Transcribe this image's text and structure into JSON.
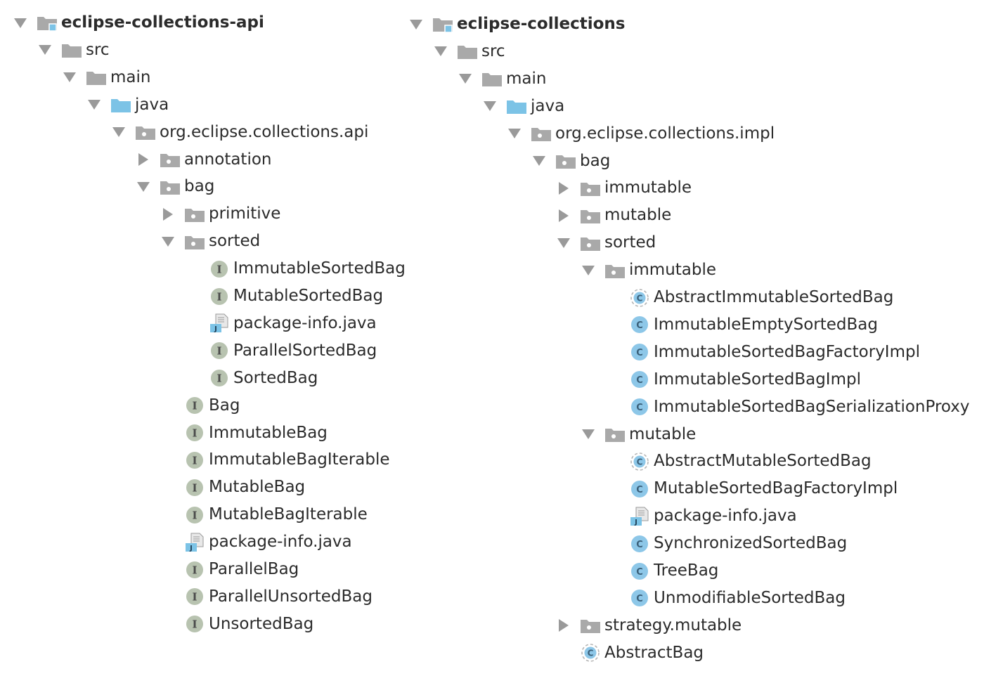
{
  "left_tree": [
    {
      "label": "eclipse-collections-api",
      "icon": "module-folder-icon",
      "arrow": "down",
      "bold": true,
      "depth": 0
    },
    {
      "label": "src",
      "icon": "folder-icon",
      "arrow": "down",
      "depth": 1
    },
    {
      "label": "main",
      "icon": "folder-icon",
      "arrow": "down",
      "depth": 2
    },
    {
      "label": "java",
      "icon": "source-folder-icon",
      "arrow": "down",
      "depth": 3
    },
    {
      "label": "org.eclipse.collections.api",
      "icon": "package-icon",
      "arrow": "down",
      "depth": 4
    },
    {
      "label": "annotation",
      "icon": "package-icon",
      "arrow": "right",
      "depth": 5
    },
    {
      "label": "bag",
      "icon": "package-icon",
      "arrow": "down",
      "depth": 5
    },
    {
      "label": "primitive",
      "icon": "package-icon",
      "arrow": "right",
      "depth": 6
    },
    {
      "label": "sorted",
      "icon": "package-icon",
      "arrow": "down",
      "depth": 6
    },
    {
      "label": "ImmutableSortedBag",
      "icon": "interface-icon",
      "arrow": "none",
      "depth": 7
    },
    {
      "label": "MutableSortedBag",
      "icon": "interface-icon",
      "arrow": "none",
      "depth": 7
    },
    {
      "label": "package-info.java",
      "icon": "java-file-icon",
      "arrow": "none",
      "depth": 7
    },
    {
      "label": "ParallelSortedBag",
      "icon": "interface-icon",
      "arrow": "none",
      "depth": 7
    },
    {
      "label": "SortedBag",
      "icon": "interface-icon",
      "arrow": "none",
      "depth": 7
    },
    {
      "label": "Bag",
      "icon": "interface-icon",
      "arrow": "none",
      "depth": 6
    },
    {
      "label": "ImmutableBag",
      "icon": "interface-icon",
      "arrow": "none",
      "depth": 6
    },
    {
      "label": "ImmutableBagIterable",
      "icon": "interface-icon",
      "arrow": "none",
      "depth": 6
    },
    {
      "label": "MutableBag",
      "icon": "interface-icon",
      "arrow": "none",
      "depth": 6
    },
    {
      "label": "MutableBagIterable",
      "icon": "interface-icon",
      "arrow": "none",
      "depth": 6
    },
    {
      "label": "package-info.java",
      "icon": "java-file-icon",
      "arrow": "none",
      "depth": 6
    },
    {
      "label": "ParallelBag",
      "icon": "interface-icon",
      "arrow": "none",
      "depth": 6
    },
    {
      "label": "ParallelUnsortedBag",
      "icon": "interface-icon",
      "arrow": "none",
      "depth": 6
    },
    {
      "label": "UnsortedBag",
      "icon": "interface-icon",
      "arrow": "none",
      "depth": 6
    }
  ],
  "right_tree": [
    {
      "label": "eclipse-collections",
      "icon": "module-folder-icon",
      "arrow": "down",
      "bold": true,
      "depth": 0
    },
    {
      "label": "src",
      "icon": "folder-icon",
      "arrow": "down",
      "depth": 1
    },
    {
      "label": "main",
      "icon": "folder-icon",
      "arrow": "down",
      "depth": 2
    },
    {
      "label": "java",
      "icon": "source-folder-icon",
      "arrow": "down",
      "depth": 3
    },
    {
      "label": "org.eclipse.collections.impl",
      "icon": "package-icon",
      "arrow": "down",
      "depth": 4
    },
    {
      "label": "bag",
      "icon": "package-icon",
      "arrow": "down",
      "depth": 5
    },
    {
      "label": "immutable",
      "icon": "package-icon",
      "arrow": "right",
      "depth": 6
    },
    {
      "label": "mutable",
      "icon": "package-icon",
      "arrow": "right",
      "depth": 6
    },
    {
      "label": "sorted",
      "icon": "package-icon",
      "arrow": "down",
      "depth": 6
    },
    {
      "label": "immutable",
      "icon": "package-icon",
      "arrow": "down",
      "depth": 7
    },
    {
      "label": "AbstractImmutableSortedBag",
      "icon": "abstract-class-icon",
      "arrow": "none",
      "depth": 8
    },
    {
      "label": "ImmutableEmptySortedBag",
      "icon": "class-icon",
      "arrow": "none",
      "depth": 8
    },
    {
      "label": "ImmutableSortedBagFactoryImpl",
      "icon": "class-icon",
      "arrow": "none",
      "depth": 8
    },
    {
      "label": "ImmutableSortedBagImpl",
      "icon": "class-icon",
      "arrow": "none",
      "depth": 8
    },
    {
      "label": "ImmutableSortedBagSerializationProxy",
      "icon": "class-icon",
      "arrow": "none",
      "depth": 8
    },
    {
      "label": "mutable",
      "icon": "package-icon",
      "arrow": "down",
      "depth": 7
    },
    {
      "label": "AbstractMutableSortedBag",
      "icon": "abstract-class-icon",
      "arrow": "none",
      "depth": 8
    },
    {
      "label": "MutableSortedBagFactoryImpl",
      "icon": "class-icon",
      "arrow": "none",
      "depth": 8
    },
    {
      "label": "package-info.java",
      "icon": "java-file-icon",
      "arrow": "none",
      "depth": 8
    },
    {
      "label": "SynchronizedSortedBag",
      "icon": "class-icon",
      "arrow": "none",
      "depth": 8
    },
    {
      "label": "TreeBag",
      "icon": "class-icon",
      "arrow": "none",
      "depth": 8
    },
    {
      "label": "UnmodifiableSortedBag",
      "icon": "class-icon",
      "arrow": "none",
      "depth": 8
    },
    {
      "label": "strategy.mutable",
      "icon": "package-icon",
      "arrow": "right",
      "depth": 6
    },
    {
      "label": "AbstractBag",
      "icon": "abstract-class-icon",
      "arrow": "none",
      "depth": 6
    }
  ],
  "icons": {
    "interface_letter": "I",
    "class_letter": "C",
    "java_file_letter": "J"
  },
  "colors": {
    "arrow": "#9a9a9a",
    "folder": "#a9a9a9",
    "source_folder": "#7cc3e6",
    "interface": "#b8c3b0",
    "class": "#8dc7e8",
    "text": "#2b2b2b"
  }
}
